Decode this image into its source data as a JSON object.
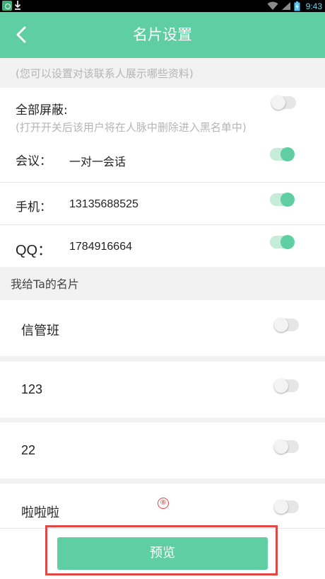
{
  "status_bar": {
    "time": "9:43",
    "icons": [
      "app-icon",
      "download-icon",
      "wifi-icon",
      "signal-icon",
      "battery-icon"
    ]
  },
  "header": {
    "title": "名片设置",
    "back_icon": "chevron-left-icon"
  },
  "privacy_hint": "(您可以设置对该联系人展示哪些资料)",
  "block_all": {
    "label": "全部屏蔽:",
    "hint": "(打开开关后该用户将在人脉中删除进入黑名单中)",
    "enabled": false
  },
  "fields": [
    {
      "label": "会议：",
      "value": "一对一会话",
      "enabled": true
    },
    {
      "label": "手机：",
      "value": "13135688525",
      "enabled": true
    },
    {
      "label": "QQ：",
      "value": "1784916664",
      "enabled": true
    }
  ],
  "cards_section": {
    "title": "我给Ta的名片",
    "cards": [
      {
        "label": "信管班",
        "enabled": false
      },
      {
        "label": "123",
        "enabled": false
      },
      {
        "label": "22",
        "enabled": false
      },
      {
        "label": "啦啦啦",
        "enabled": false
      }
    ]
  },
  "annotation_marker": "⑧",
  "preview_button": "预览",
  "colors": {
    "accent": "#5fcfa3",
    "switch_on_track": "#c5ecd9",
    "highlight": "#e04848",
    "hint_text": "#b5b5b5"
  }
}
